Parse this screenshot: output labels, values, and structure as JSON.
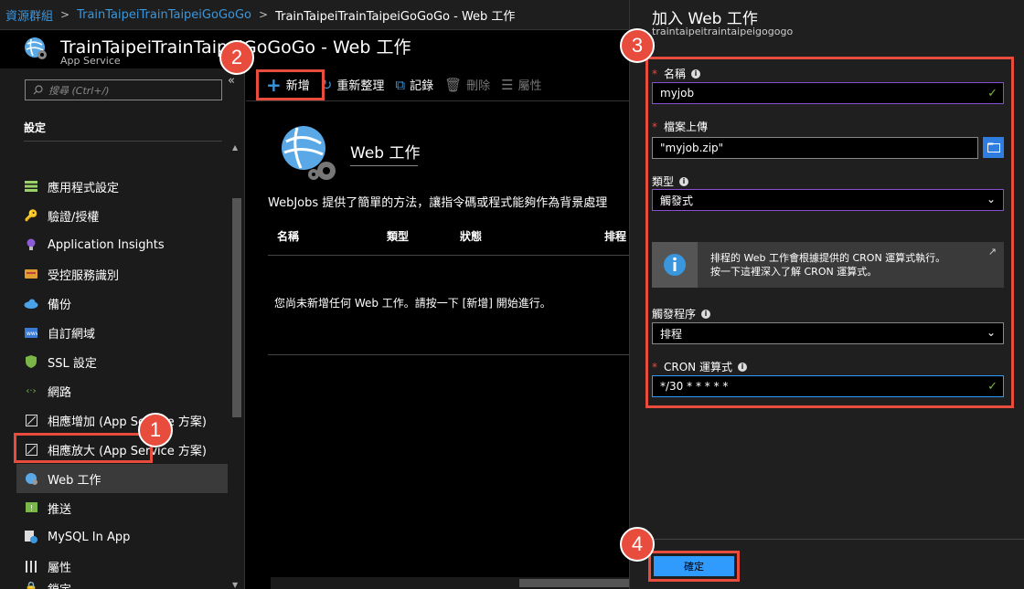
{
  "breadcrumb": {
    "items": [
      "資源群組",
      "TrainTaipeiTrainTaipeiGoGoGo",
      "TrainTaipeiTrainTaipeiGoGoGo - Web 工作"
    ]
  },
  "resource": {
    "title": "TrainTaipeiTrainTaipeiGoGoGo - Web 工作",
    "subtitle": "App Service"
  },
  "nav": {
    "search_placeholder": "搜尋 (Ctrl+/)",
    "section": "設定",
    "items": [
      {
        "label": "應用程式設定",
        "icon": "app-settings-icon"
      },
      {
        "label": "驗證/授權",
        "icon": "key-icon"
      },
      {
        "label": "Application Insights",
        "icon": "insights-bulb-icon"
      },
      {
        "label": "受控服務識別",
        "icon": "identity-card-icon"
      },
      {
        "label": "備份",
        "icon": "cloud-backup-icon"
      },
      {
        "label": "自訂網域",
        "icon": "domain-icon"
      },
      {
        "label": "SSL 設定",
        "icon": "shield-icon"
      },
      {
        "label": "網路",
        "icon": "network-icon"
      },
      {
        "label": "相應增加 (App Service 方案)",
        "icon": "scale-up-icon"
      },
      {
        "label": "相應放大 (App Service 方案)",
        "icon": "scale-out-icon"
      },
      {
        "label": "Web 工作",
        "icon": "webjobs-icon"
      },
      {
        "label": "推送",
        "icon": "push-icon"
      },
      {
        "label": "MySQL In App",
        "icon": "mysql-icon"
      },
      {
        "label": "屬性",
        "icon": "properties-icon"
      },
      {
        "label": "鎖定",
        "icon": "lock-icon"
      }
    ]
  },
  "toolbar": {
    "add": "新增",
    "refresh": "重新整理",
    "logs": "記錄",
    "delete": "刪除",
    "properties": "屬性"
  },
  "main": {
    "hero_title": "Web 工作",
    "description": "WebJobs 提供了簡單的方法，讓指令碼或程式能夠作為背景處理",
    "columns": [
      "名稱",
      "類型",
      "狀態",
      "排程"
    ],
    "empty_message": "您尚未新增任何 Web 工作。請按一下 [新增] 開始進行。"
  },
  "form": {
    "title": "加入 Web 工作",
    "subtitle": "traintaipeitraintaipeigogogo",
    "name_label": "名稱",
    "name_value": "myjob",
    "upload_label": "檔案上傳",
    "upload_value": "\"myjob.zip\"",
    "type_label": "類型",
    "type_value": "觸發式",
    "info_line1": "排程的 Web 工作會根據提供的 CRON 運算式執行。",
    "info_line2": "按一下這裡深入了解 CRON 運算式。",
    "trigger_label": "觸發程序",
    "trigger_value": "排程",
    "cron_label": "CRON 運算式",
    "cron_value": "*/30 * * * * *",
    "confirm": "確定"
  },
  "badges": [
    "1",
    "2",
    "3",
    "4"
  ],
  "colors": {
    "highlight": "#e74c3c",
    "accent": "#2f9bff",
    "valid": "#7ab648"
  }
}
